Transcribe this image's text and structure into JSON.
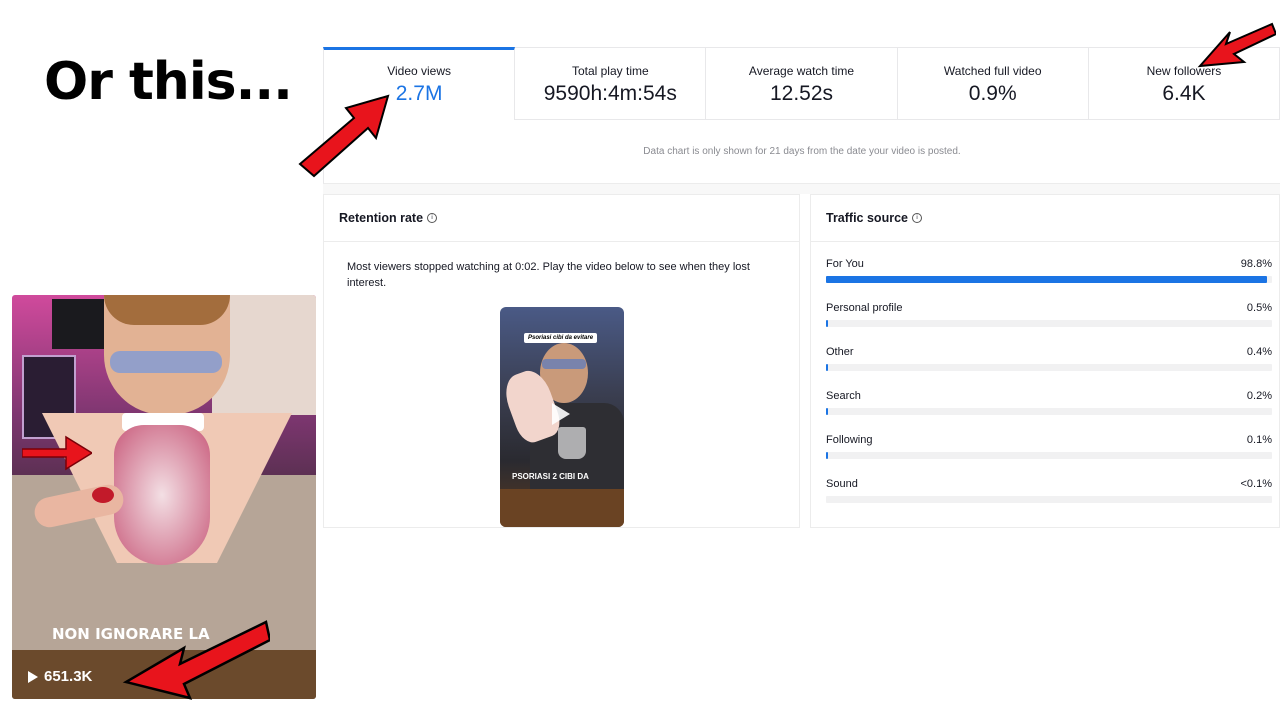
{
  "heading": "Or this...",
  "stats": [
    {
      "label": "Video views",
      "value": "2.7M"
    },
    {
      "label": "Total play time",
      "value": "9590h:4m:54s"
    },
    {
      "label": "Average watch time",
      "value": "12.52s"
    },
    {
      "label": "Watched full video",
      "value": "0.9%"
    },
    {
      "label": "New followers",
      "value": "6.4K"
    }
  ],
  "chart_note": "Data chart is only shown for 21 days from the date your video is posted.",
  "retention": {
    "title": "Retention rate",
    "text": "Most viewers stopped watching at 0:02. Play the video below to see when they lost interest.",
    "thumb_caption": "Psoriasi cibi da evitare",
    "thumb_text": "PSORIASI 2 CIBI DA"
  },
  "traffic": {
    "title": "Traffic source",
    "rows": [
      {
        "label": "For You",
        "value": "98.8%",
        "fraction": 0.988
      },
      {
        "label": "Personal profile",
        "value": "0.5%",
        "fraction": 0.005
      },
      {
        "label": "Other",
        "value": "0.4%",
        "fraction": 0.004
      },
      {
        "label": "Search",
        "value": "0.2%",
        "fraction": 0.002
      },
      {
        "label": "Following",
        "value": "0.1%",
        "fraction": 0.001
      },
      {
        "label": "Sound",
        "value": "<0.1%",
        "fraction": 0
      }
    ]
  },
  "phone": {
    "caption": "NON IGNORARE LA",
    "views": "651.3K"
  },
  "colors": {
    "accent": "#1b74e4",
    "arrow": "#e8141c"
  }
}
